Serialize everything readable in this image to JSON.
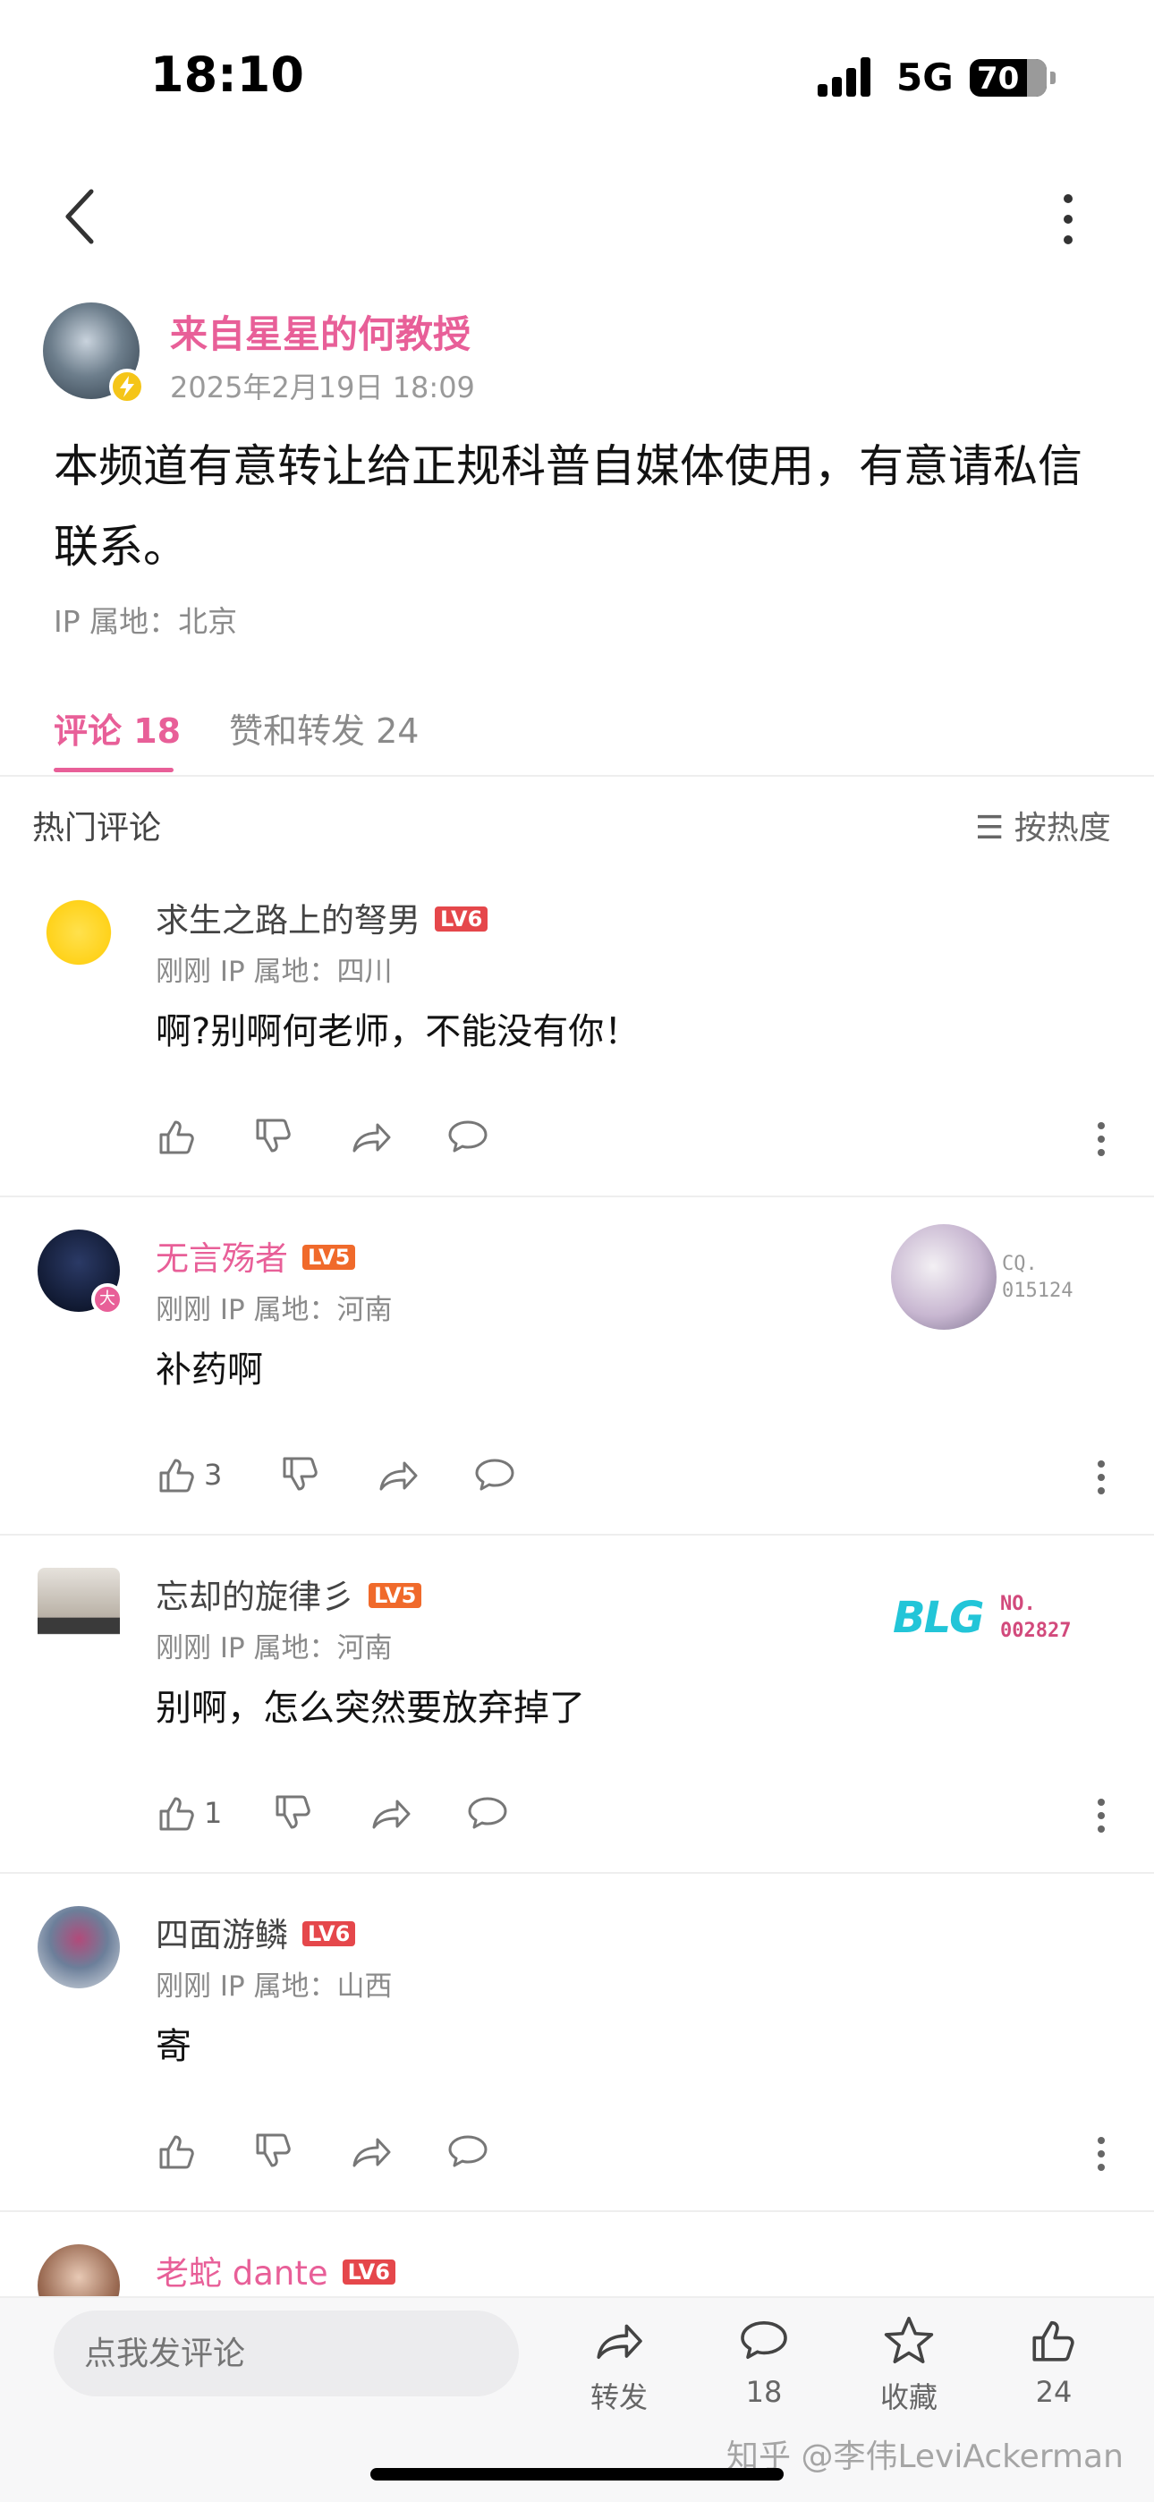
{
  "status_bar": {
    "time": "18:10",
    "network": "5G",
    "battery": "70"
  },
  "post": {
    "author": "来自星星的何教授",
    "time": "2025年2月19日 18:09",
    "content": "本频道有意转让给正规科普自媒体使用，有意请私信联系。",
    "ip": "IP 属地：北京"
  },
  "tabs": [
    {
      "label": "评论 18"
    },
    {
      "label": "赞和转发 24"
    }
  ],
  "comments_header": {
    "title": "热门评论",
    "sort": "☰ 按热度"
  },
  "comments": [
    {
      "name": "求生之路上的弩男",
      "level": "LV6",
      "meta": "刚刚  IP 属地：四川",
      "text": "啊?别啊何老师，不能没有你！",
      "like_count": ""
    },
    {
      "name": "无言殇者",
      "level": "LV5",
      "meta": "刚刚  IP 属地：河南",
      "text": "补药啊",
      "like_count": "3",
      "medal_no": [
        "CQ.",
        "015124"
      ],
      "avatar_badge": "大"
    },
    {
      "name": "忘却的旋律彡",
      "level": "LV5",
      "meta": "刚刚  IP 属地：河南",
      "text": "别啊，怎么突然要放弃掉了",
      "like_count": "1",
      "medal_logo": "BLG",
      "medal_no": [
        "NO.",
        "002827"
      ]
    },
    {
      "name": "四面游鳞",
      "level": "LV6",
      "meta": "刚刚  IP 属地：山西",
      "text": "寄",
      "like_count": ""
    },
    {
      "name": "老蛇 dante",
      "level": "LV6"
    }
  ],
  "bottom_bar": {
    "input_placeholder": "点我发评论",
    "share_label": "转发",
    "comment_count": "18",
    "favorite_label": "收藏",
    "like_count": "24"
  },
  "watermark": "知乎 @李伟LeviAckerman",
  "colors": {
    "accent_pink": "#e85f98",
    "lv6": "#e5474b",
    "lv5": "#f06a2b"
  }
}
